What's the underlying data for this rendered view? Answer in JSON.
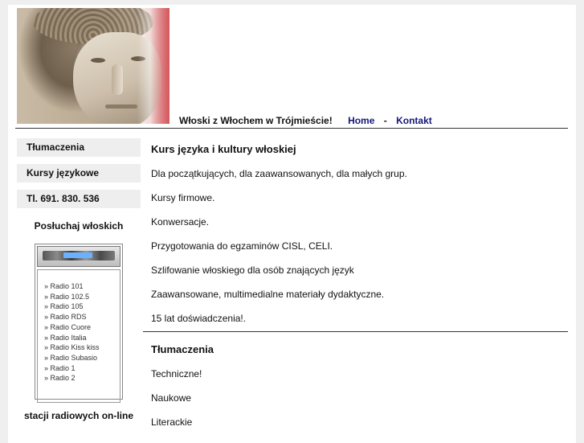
{
  "header": {
    "slogan": "Włoski z Włochem w Trójmieście!",
    "nav": [
      {
        "label": "Home"
      },
      {
        "label": "Kontakt"
      }
    ],
    "separator": "-"
  },
  "sidebar": {
    "items": [
      {
        "label": "Tłumaczenia"
      },
      {
        "label": "Kursy językowe"
      },
      {
        "label": "Tl. 691. 830. 536"
      }
    ],
    "radio_title": "Posłuchaj włoskich",
    "stations": [
      "» Radio 101",
      "» Radio 102.5",
      "» Radio 105",
      "» Radio RDS",
      "» Radio Cuore",
      "» Radio Italia",
      "» Radio Kiss kiss",
      "» Radio Subasio",
      "» Radio 1",
      "» Radio 2"
    ],
    "radio_footer": "stacji radiowych on-line"
  },
  "main": {
    "section1": {
      "title": "Kurs języka i kultury włoskiej",
      "lines": [
        "Dla początkujących, dla zaawansowanych, dla małych grup.",
        "Kursy firmowe.",
        "Konwersacje.",
        "Przygotowania do egzaminów CISL, CELI.",
        "Szlifowanie włoskiego dla osób znających język",
        "Zaawansowane, multimedialne materiały dydaktyczne.",
        "15 lat doświadczenia!."
      ]
    },
    "section2": {
      "title": "Tłumaczenia",
      "lines": [
        "Techniczne!",
        "Naukowe",
        "Literackie"
      ]
    }
  }
}
